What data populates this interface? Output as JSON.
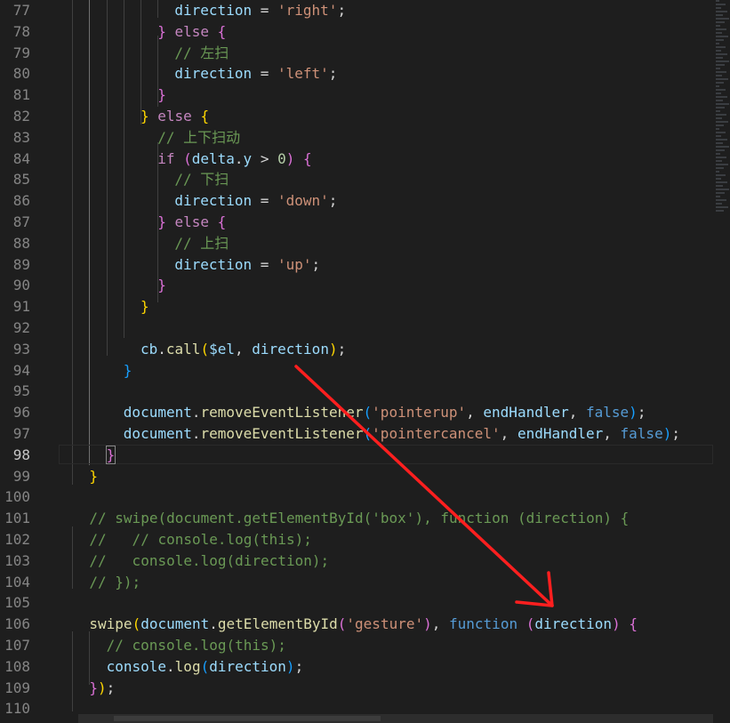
{
  "editor": {
    "lines": [
      {
        "n": "77",
        "tokens": [
          [
            "vr",
            "direction"
          ],
          [
            "op",
            " = "
          ],
          [
            "st",
            "'right'"
          ],
          [
            "op",
            ";"
          ]
        ]
      },
      {
        "n": "78",
        "tokens": [
          [
            "b2",
            "}"
          ],
          [
            "op",
            " "
          ],
          [
            "kw",
            "else"
          ],
          [
            "op",
            " "
          ],
          [
            "b2",
            "{"
          ]
        ]
      },
      {
        "n": "79",
        "tokens": [
          [
            "cm",
            "// 左扫"
          ]
        ]
      },
      {
        "n": "80",
        "tokens": [
          [
            "vr",
            "direction"
          ],
          [
            "op",
            " = "
          ],
          [
            "st",
            "'left'"
          ],
          [
            "op",
            ";"
          ]
        ]
      },
      {
        "n": "81",
        "tokens": [
          [
            "b2",
            "}"
          ]
        ]
      },
      {
        "n": "82",
        "tokens": [
          [
            "b1",
            "}"
          ],
          [
            "op",
            " "
          ],
          [
            "kw",
            "else"
          ],
          [
            "op",
            " "
          ],
          [
            "b1",
            "{"
          ]
        ]
      },
      {
        "n": "83",
        "tokens": [
          [
            "cm",
            "// 上下扫动"
          ]
        ]
      },
      {
        "n": "84",
        "tokens": [
          [
            "kw",
            "if"
          ],
          [
            "op",
            " "
          ],
          [
            "b2",
            "("
          ],
          [
            "vr",
            "delta"
          ],
          [
            "op",
            "."
          ],
          [
            "vr",
            "y"
          ],
          [
            "op",
            " > "
          ],
          [
            "nm",
            "0"
          ],
          [
            "b2",
            ")"
          ],
          [
            "op",
            " "
          ],
          [
            "b2",
            "{"
          ]
        ]
      },
      {
        "n": "85",
        "tokens": [
          [
            "cm",
            "// 下扫"
          ]
        ]
      },
      {
        "n": "86",
        "tokens": [
          [
            "vr",
            "direction"
          ],
          [
            "op",
            " = "
          ],
          [
            "st",
            "'down'"
          ],
          [
            "op",
            ";"
          ]
        ]
      },
      {
        "n": "87",
        "tokens": [
          [
            "b2",
            "}"
          ],
          [
            "op",
            " "
          ],
          [
            "kw",
            "else"
          ],
          [
            "op",
            " "
          ],
          [
            "b2",
            "{"
          ]
        ]
      },
      {
        "n": "88",
        "tokens": [
          [
            "cm",
            "// 上扫"
          ]
        ]
      },
      {
        "n": "89",
        "tokens": [
          [
            "vr",
            "direction"
          ],
          [
            "op",
            " = "
          ],
          [
            "st",
            "'up'"
          ],
          [
            "op",
            ";"
          ]
        ]
      },
      {
        "n": "90",
        "tokens": [
          [
            "b2",
            "}"
          ]
        ]
      },
      {
        "n": "91",
        "tokens": [
          [
            "b1",
            "}"
          ]
        ]
      },
      {
        "n": "92",
        "tokens": []
      },
      {
        "n": "93",
        "tokens": [
          [
            "vr",
            "cb"
          ],
          [
            "op",
            "."
          ],
          [
            "fn",
            "call"
          ],
          [
            "b1",
            "("
          ],
          [
            "vr",
            "$el"
          ],
          [
            "op",
            ", "
          ],
          [
            "vr",
            "direction"
          ],
          [
            "b1",
            ")"
          ],
          [
            "op",
            ";"
          ]
        ]
      },
      {
        "n": "94",
        "tokens": [
          [
            "b3",
            "}"
          ]
        ]
      },
      {
        "n": "95",
        "tokens": []
      },
      {
        "n": "96",
        "tokens": [
          [
            "vr",
            "document"
          ],
          [
            "op",
            "."
          ],
          [
            "fn",
            "removeEventListener"
          ],
          [
            "b3",
            "("
          ],
          [
            "st",
            "'pointerup'"
          ],
          [
            "op",
            ", "
          ],
          [
            "vr",
            "endHandler"
          ],
          [
            "op",
            ", "
          ],
          [
            "bl",
            "false"
          ],
          [
            "b3",
            ")"
          ],
          [
            "op",
            ";"
          ]
        ]
      },
      {
        "n": "97",
        "tokens": [
          [
            "vr",
            "document"
          ],
          [
            "op",
            "."
          ],
          [
            "fn",
            "removeEventListener"
          ],
          [
            "b3",
            "("
          ],
          [
            "st",
            "'pointercancel'"
          ],
          [
            "op",
            ", "
          ],
          [
            "vr",
            "endHandler"
          ],
          [
            "op",
            ", "
          ],
          [
            "bl",
            "false"
          ],
          [
            "b3",
            ")"
          ],
          [
            "op",
            ";"
          ]
        ]
      },
      {
        "n": "98",
        "tokens": [
          [
            "b2",
            "}"
          ]
        ]
      },
      {
        "n": "99",
        "tokens": [
          [
            "b1",
            "}"
          ]
        ]
      },
      {
        "n": "100",
        "tokens": []
      },
      {
        "n": "101",
        "tokens": [
          [
            "cm",
            "// swipe(document.getElementById('box'), function (direction) {"
          ]
        ]
      },
      {
        "n": "102",
        "tokens": [
          [
            "cm",
            "//   // console.log(this);"
          ]
        ]
      },
      {
        "n": "103",
        "tokens": [
          [
            "cm",
            "//   console.log(direction);"
          ]
        ]
      },
      {
        "n": "104",
        "tokens": [
          [
            "cm",
            "// });"
          ]
        ]
      },
      {
        "n": "105",
        "tokens": []
      },
      {
        "n": "106",
        "tokens": [
          [
            "fn",
            "swipe"
          ],
          [
            "b1",
            "("
          ],
          [
            "vr",
            "document"
          ],
          [
            "op",
            "."
          ],
          [
            "fn",
            "getElementById"
          ],
          [
            "b2",
            "("
          ],
          [
            "st",
            "'gesture'"
          ],
          [
            "b2",
            ")"
          ],
          [
            "op",
            ", "
          ],
          [
            "bl",
            "function"
          ],
          [
            "op",
            " "
          ],
          [
            "b2",
            "("
          ],
          [
            "vr",
            "direction"
          ],
          [
            "b2",
            ")"
          ],
          [
            "op",
            " "
          ],
          [
            "b2",
            "{"
          ]
        ]
      },
      {
        "n": "107",
        "tokens": [
          [
            "cm",
            "// console.log(this);"
          ]
        ]
      },
      {
        "n": "108",
        "tokens": [
          [
            "vr",
            "console"
          ],
          [
            "op",
            "."
          ],
          [
            "fn",
            "log"
          ],
          [
            "b3",
            "("
          ],
          [
            "vr",
            "direction"
          ],
          [
            "b3",
            ")"
          ],
          [
            "op",
            ";"
          ]
        ]
      },
      {
        "n": "109",
        "tokens": [
          [
            "b2",
            "}"
          ],
          [
            "b1",
            ")"
          ],
          [
            "op",
            ";"
          ]
        ]
      },
      {
        "n": "110",
        "tokens": []
      }
    ],
    "active_line": "98",
    "colors": {
      "background": "#1e1e1e",
      "annotation_arrow": "#ff1f1f"
    }
  }
}
